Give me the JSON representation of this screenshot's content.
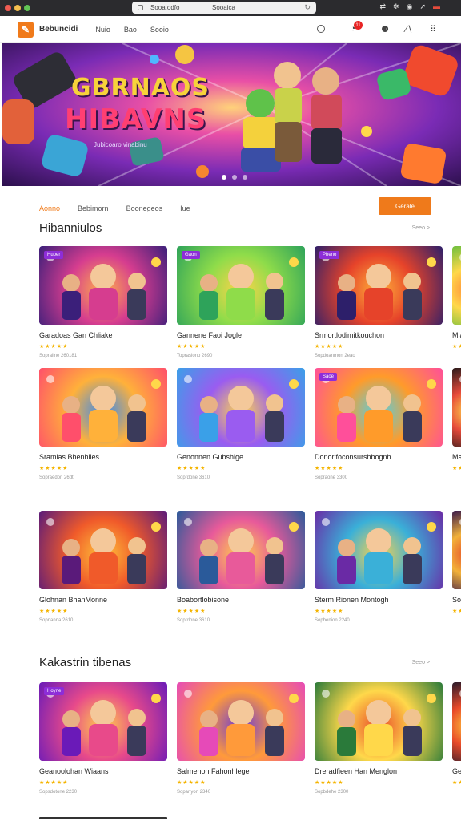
{
  "browser": {
    "host": "Sooaica",
    "addr": "Sooa.odfo",
    "dots": [
      "#ef5b52",
      "#f4bf4f",
      "#62c555"
    ]
  },
  "nav": {
    "brand": "Bebuncidi",
    "links": [
      "Nuio",
      "Bao",
      "Sooio"
    ],
    "badge": "11"
  },
  "hero": {
    "title_line1": "GBRNAOS",
    "title_line2": "HIBAVNS",
    "subtitle": "Jubicoaro  vinabinu"
  },
  "tabs": {
    "items": [
      "Aonno",
      "Bebimorn",
      "Boonegeos",
      "Iue"
    ],
    "button": "Gerale"
  },
  "sections": [
    {
      "title": "Hibanniulos",
      "see_all": "Seeo >",
      "rows": [
        [
          {
            "title": "Garadoas Gan Chliake",
            "tag": "Huoer",
            "meta": "Sopraline 260181"
          },
          {
            "title": "Gannene Faoi Jogle",
            "tag": "Gaon",
            "meta": "Toprasiono 2690"
          },
          {
            "title": "Srmortlodimitkouchon",
            "tag": "Pheno",
            "meta": "Sopdoanmon 2eao"
          },
          {
            "title": "Mianeo",
            "tag": "",
            "meta": ""
          }
        ],
        [
          {
            "title": "Sramias Bhenhiles",
            "tag": "",
            "meta": "Sopraedon 26dt"
          },
          {
            "title": "Genonnen Gubshlge",
            "tag": "",
            "meta": "Soprdone 3610"
          },
          {
            "title": "Donorifoconsurshbognh",
            "tag": "Saoe",
            "meta": "Sopraone 3300"
          },
          {
            "title": "Macloe",
            "tag": "",
            "meta": ""
          }
        ],
        [
          {
            "title": "Glohnan BhanMonne",
            "tag": "",
            "meta": "Sopnanna 2610"
          },
          {
            "title": "Boabortlobisone",
            "tag": "",
            "meta": "Soprdone 3610"
          },
          {
            "title": "Sterm Rionen Montogh",
            "tag": "",
            "meta": "Sopbenion 2240"
          },
          {
            "title": "Sooinon",
            "tag": "",
            "meta": ""
          }
        ]
      ]
    },
    {
      "title": "Kakastrin tibenas",
      "see_all": "Seeo >",
      "rows": [
        [
          {
            "title": "Geanoolohan Wiaans",
            "tag": "Hoyne",
            "meta": "Sopsdotone 2230"
          },
          {
            "title": "Salmenon Fahonhlege",
            "tag": "",
            "meta": "Sopanyon 2340"
          },
          {
            "title": "Dreradfieen Han Menglon",
            "tag": "",
            "meta": "Sopbdehe 2300"
          },
          {
            "title": "Geelan",
            "tag": "",
            "meta": ""
          }
        ]
      ]
    }
  ],
  "rating": "★★★★★",
  "colors": {
    "accent": "#ef7a1b",
    "tag": "#8d2dd8",
    "star": "#f4b400"
  }
}
